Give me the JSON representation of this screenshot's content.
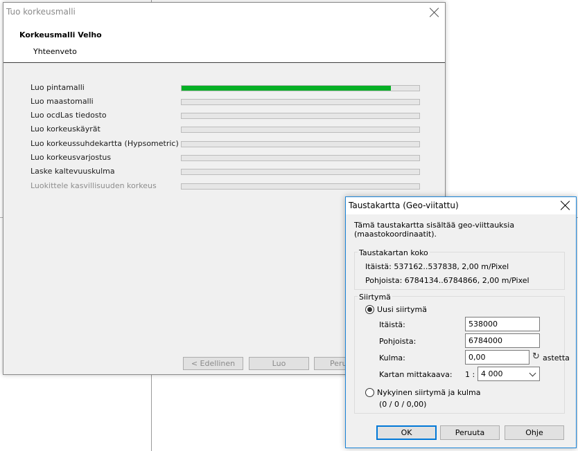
{
  "wizard": {
    "window_title": "Tuo korkeusmalli",
    "header_title": "Korkeusmalli Velho",
    "header_subtitle": "Yhteenveto",
    "tasks": [
      {
        "label": "Luo pintamalli",
        "progress": 0.88,
        "disabled": false
      },
      {
        "label": "Luo maastomalli",
        "progress": 0,
        "disabled": false
      },
      {
        "label": "Luo ocdLas tiedosto",
        "progress": 0,
        "disabled": false
      },
      {
        "label": "Luo korkeuskäyrät",
        "progress": 0,
        "disabled": false
      },
      {
        "label": "Luo korkeussuhdekartta (Hypsometric)",
        "progress": 0,
        "disabled": false
      },
      {
        "label": "Luo korkeusvarjostus",
        "progress": 0,
        "disabled": false
      },
      {
        "label": "Laske kaltevuuskulma",
        "progress": 0,
        "disabled": false
      },
      {
        "label": "Luokittele kasvillisuuden korkeus",
        "progress": 0,
        "disabled": true
      }
    ],
    "buttons": {
      "previous": "< Edellinen",
      "create": "Luo",
      "cancel": "Peru"
    },
    "progress_color": "#06b025"
  },
  "geo_dialog": {
    "title": "Taustakartta (Geo-viitattu)",
    "intro_line1": "Tämä taustakartta sisältää geo-viittauksia",
    "intro_line2": "(maastokoordinaatit).",
    "size_group": {
      "legend": "Taustakartan koko",
      "east": "Itäistä: 537162..537838,  2,00 m/Pixel",
      "north": "Pohjoista: 6784134..6784866,  2,00 m/Pixel"
    },
    "offset_group": {
      "legend": "Siirtymä",
      "option_new": "Uusi siirtymä",
      "east_label": "Itäistä:",
      "east_value": "538000",
      "north_label": "Pohjoista:",
      "north_value": "6784000",
      "angle_label": "Kulma:",
      "angle_value": "0,00",
      "set_link": "astetta",
      "scale_label": "Kartan mittakaava:",
      "scale_prefix": "1 :",
      "scale_value": "4 000",
      "option_current": "Nykyinen siirtymä ja kulma",
      "current_values": "(0 / 0 / 0,00)"
    },
    "buttons": {
      "ok": "OK",
      "cancel": "Peruuta",
      "help": "Ohje"
    }
  }
}
